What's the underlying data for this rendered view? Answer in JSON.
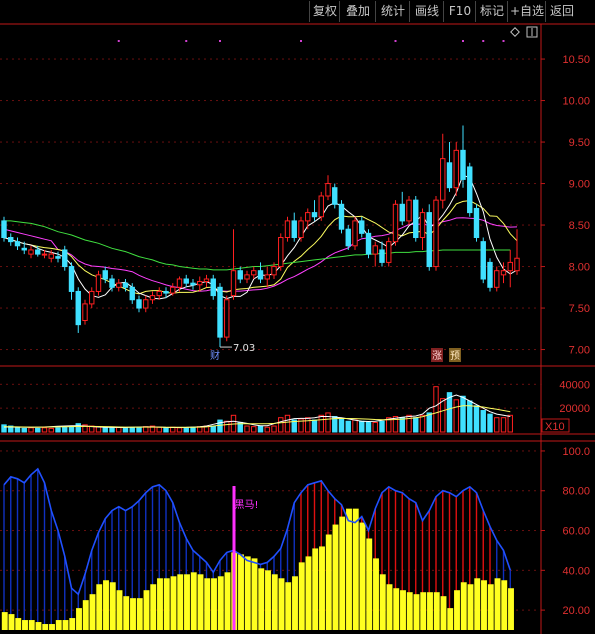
{
  "toolbar": {
    "buttons": [
      "复权",
      "叠加",
      "统计",
      "画线",
      "F10",
      "标记",
      "+自选",
      "返回"
    ]
  },
  "colors": {
    "background": "#000000",
    "up": "#ff2020",
    "down": "#40e0ff",
    "ma5": "#ffffff",
    "ma10": "#ffff60",
    "ma20": "#ff40ff",
    "ma60": "#40e040",
    "axis": "#c01818",
    "indicator_blue": "#1030c0",
    "indicator_red": "#e01010",
    "indicator_yellow": "#ffff20",
    "signal": "#ff30ff"
  },
  "annotations": {
    "low_price": "7.03",
    "finance_tag": "财",
    "rise_tag": "涨",
    "forecast_tag": "预",
    "signal_text": "黑马!",
    "volume_unit": "X10"
  },
  "chart_data": [
    {
      "type": "candlestick",
      "name": "price",
      "y_ticks": [
        "10.50",
        "10.00",
        "9.50",
        "9.00",
        "8.50",
        "8.00",
        "7.50",
        "7.00"
      ],
      "ylim": [
        6.85,
        10.85
      ],
      "candles": [
        {
          "o": 8.55,
          "h": 8.6,
          "l": 8.3,
          "c": 8.35
        },
        {
          "o": 8.35,
          "h": 8.4,
          "l": 8.25,
          "c": 8.3
        },
        {
          "o": 8.3,
          "h": 8.35,
          "l": 8.2,
          "c": 8.25
        },
        {
          "o": 8.22,
          "h": 8.3,
          "l": 8.15,
          "c": 8.2
        },
        {
          "o": 8.15,
          "h": 8.25,
          "l": 8.1,
          "c": 8.2
        },
        {
          "o": 8.2,
          "h": 8.25,
          "l": 8.12,
          "c": 8.15
        },
        {
          "o": 8.15,
          "h": 8.2,
          "l": 8.1,
          "c": 8.15
        },
        {
          "o": 8.1,
          "h": 8.2,
          "l": 8.05,
          "c": 8.15
        },
        {
          "o": 8.12,
          "h": 8.18,
          "l": 8.05,
          "c": 8.1
        },
        {
          "o": 8.2,
          "h": 8.25,
          "l": 7.95,
          "c": 8.0
        },
        {
          "o": 8.0,
          "h": 8.05,
          "l": 7.6,
          "c": 7.7
        },
        {
          "o": 7.7,
          "h": 7.75,
          "l": 7.2,
          "c": 7.3
        },
        {
          "o": 7.35,
          "h": 7.6,
          "l": 7.3,
          "c": 7.55
        },
        {
          "o": 7.55,
          "h": 7.75,
          "l": 7.5,
          "c": 7.7
        },
        {
          "o": 7.7,
          "h": 7.95,
          "l": 7.65,
          "c": 7.9
        },
        {
          "o": 7.95,
          "h": 8.0,
          "l": 7.8,
          "c": 7.85
        },
        {
          "o": 7.85,
          "h": 7.9,
          "l": 7.7,
          "c": 7.75
        },
        {
          "o": 7.75,
          "h": 7.85,
          "l": 7.7,
          "c": 7.8
        },
        {
          "o": 7.8,
          "h": 7.85,
          "l": 7.7,
          "c": 7.75
        },
        {
          "o": 7.75,
          "h": 7.8,
          "l": 7.55,
          "c": 7.6
        },
        {
          "o": 7.6,
          "h": 7.65,
          "l": 7.45,
          "c": 7.5
        },
        {
          "o": 7.5,
          "h": 7.65,
          "l": 7.45,
          "c": 7.6
        },
        {
          "o": 7.6,
          "h": 7.7,
          "l": 7.55,
          "c": 7.65
        },
        {
          "o": 7.65,
          "h": 7.75,
          "l": 7.6,
          "c": 7.7
        },
        {
          "o": 7.7,
          "h": 7.75,
          "l": 7.62,
          "c": 7.68
        },
        {
          "o": 7.68,
          "h": 7.8,
          "l": 7.65,
          "c": 7.75
        },
        {
          "o": 7.75,
          "h": 7.88,
          "l": 7.7,
          "c": 7.85
        },
        {
          "o": 7.85,
          "h": 7.9,
          "l": 7.75,
          "c": 7.8
        },
        {
          "o": 7.8,
          "h": 7.85,
          "l": 7.72,
          "c": 7.78
        },
        {
          "o": 7.78,
          "h": 7.88,
          "l": 7.7,
          "c": 7.82
        },
        {
          "o": 7.82,
          "h": 7.9,
          "l": 7.75,
          "c": 7.85
        },
        {
          "o": 7.85,
          "h": 7.9,
          "l": 7.6,
          "c": 7.65
        },
        {
          "o": 7.75,
          "h": 7.8,
          "l": 7.03,
          "c": 7.15
        },
        {
          "o": 7.15,
          "h": 7.65,
          "l": 7.1,
          "c": 7.6
        },
        {
          "o": 7.65,
          "h": 8.45,
          "l": 7.6,
          "c": 7.95
        },
        {
          "o": 7.95,
          "h": 8.0,
          "l": 7.8,
          "c": 7.85
        },
        {
          "o": 7.85,
          "h": 7.95,
          "l": 7.8,
          "c": 7.9
        },
        {
          "o": 7.9,
          "h": 8.0,
          "l": 7.85,
          "c": 7.95
        },
        {
          "o": 7.95,
          "h": 8.05,
          "l": 7.8,
          "c": 7.85
        },
        {
          "o": 7.85,
          "h": 8.0,
          "l": 7.75,
          "c": 7.9
        },
        {
          "o": 7.9,
          "h": 8.05,
          "l": 7.85,
          "c": 8.0
        },
        {
          "o": 8.0,
          "h": 8.4,
          "l": 7.95,
          "c": 8.35
        },
        {
          "o": 8.35,
          "h": 8.6,
          "l": 8.3,
          "c": 8.55
        },
        {
          "o": 8.55,
          "h": 8.65,
          "l": 8.3,
          "c": 8.35
        },
        {
          "o": 8.35,
          "h": 8.6,
          "l": 8.3,
          "c": 8.55
        },
        {
          "o": 8.55,
          "h": 8.7,
          "l": 8.45,
          "c": 8.65
        },
        {
          "o": 8.65,
          "h": 8.8,
          "l": 8.55,
          "c": 8.6
        },
        {
          "o": 8.6,
          "h": 8.9,
          "l": 8.55,
          "c": 8.85
        },
        {
          "o": 8.85,
          "h": 9.1,
          "l": 8.8,
          "c": 9.0
        },
        {
          "o": 8.95,
          "h": 9.0,
          "l": 8.7,
          "c": 8.75
        },
        {
          "o": 8.75,
          "h": 8.8,
          "l": 8.4,
          "c": 8.45
        },
        {
          "o": 8.45,
          "h": 8.5,
          "l": 8.2,
          "c": 8.25
        },
        {
          "o": 8.25,
          "h": 8.6,
          "l": 8.2,
          "c": 8.55
        },
        {
          "o": 8.55,
          "h": 8.6,
          "l": 8.35,
          "c": 8.4
        },
        {
          "o": 8.4,
          "h": 8.45,
          "l": 8.1,
          "c": 8.15
        },
        {
          "o": 8.15,
          "h": 8.3,
          "l": 8.0,
          "c": 8.25
        },
        {
          "o": 8.2,
          "h": 8.3,
          "l": 8.0,
          "c": 8.05
        },
        {
          "o": 8.05,
          "h": 8.35,
          "l": 8.0,
          "c": 8.3
        },
        {
          "o": 8.3,
          "h": 8.8,
          "l": 8.25,
          "c": 8.75
        },
        {
          "o": 8.75,
          "h": 8.9,
          "l": 8.5,
          "c": 8.55
        },
        {
          "o": 8.55,
          "h": 8.85,
          "l": 8.5,
          "c": 8.8
        },
        {
          "o": 8.8,
          "h": 8.85,
          "l": 8.3,
          "c": 8.35
        },
        {
          "o": 8.35,
          "h": 8.7,
          "l": 8.2,
          "c": 8.65
        },
        {
          "o": 8.65,
          "h": 8.75,
          "l": 7.95,
          "c": 8.0
        },
        {
          "o": 8.0,
          "h": 8.85,
          "l": 7.95,
          "c": 8.8
        },
        {
          "o": 8.8,
          "h": 9.6,
          "l": 8.7,
          "c": 9.3
        },
        {
          "o": 9.25,
          "h": 9.5,
          "l": 8.9,
          "c": 8.95
        },
        {
          "o": 8.95,
          "h": 9.5,
          "l": 8.85,
          "c": 9.4
        },
        {
          "o": 9.4,
          "h": 9.7,
          "l": 8.95,
          "c": 9.05
        },
        {
          "o": 9.2,
          "h": 9.25,
          "l": 8.6,
          "c": 8.65
        },
        {
          "o": 8.7,
          "h": 8.75,
          "l": 8.3,
          "c": 8.35
        },
        {
          "o": 8.3,
          "h": 8.35,
          "l": 7.8,
          "c": 7.85
        },
        {
          "o": 8.05,
          "h": 8.1,
          "l": 7.7,
          "c": 7.75
        },
        {
          "o": 7.75,
          "h": 8.0,
          "l": 7.7,
          "c": 7.95
        },
        {
          "o": 7.9,
          "h": 8.05,
          "l": 7.8,
          "c": 7.95
        },
        {
          "o": 7.95,
          "h": 8.2,
          "l": 7.75,
          "c": 8.05
        },
        {
          "o": 7.95,
          "h": 8.45,
          "l": 7.9,
          "c": 8.1
        }
      ],
      "mark_dots": [
        17,
        27,
        32,
        44,
        58,
        68,
        71,
        74
      ]
    },
    {
      "type": "bar",
      "name": "volume",
      "y_ticks": [
        "40000",
        "20000"
      ],
      "ylim": [
        0,
        52000
      ],
      "values": [
        6000,
        5000,
        4000,
        3000,
        3500,
        3000,
        3500,
        3000,
        3500,
        4000,
        5000,
        7000,
        6000,
        5000,
        4500,
        4000,
        3500,
        4000,
        3500,
        3500,
        4000,
        4500,
        5000,
        4000,
        3500,
        4000,
        3500,
        3500,
        4000,
        4500,
        5000,
        5000,
        10000,
        9000,
        14000,
        8000,
        5000,
        4500,
        5000,
        4000,
        5000,
        12000,
        14000,
        10000,
        11000,
        12000,
        10000,
        14000,
        16000,
        13000,
        11000,
        9000,
        10000,
        9000,
        8000,
        8000,
        9000,
        12000,
        13000,
        12000,
        14000,
        12000,
        14000,
        16000,
        38000,
        28000,
        33000,
        27000,
        30000,
        26000,
        22000,
        18000,
        15000,
        12000,
        12000,
        14000
      ],
      "ma5": [
        4200,
        4200,
        4100,
        4000,
        4000,
        4000,
        4200,
        4500,
        4800,
        5000,
        5200,
        5200,
        5000,
        4500,
        4200,
        4000,
        3900,
        3800,
        3800,
        4000,
        4200,
        4300,
        4300,
        4100,
        3900,
        3800,
        3800,
        3900,
        4100,
        4400,
        5000,
        6500,
        7700,
        8600,
        9000,
        8200,
        7200,
        6000,
        5200,
        5300,
        7000,
        8600,
        10000,
        11200,
        11400,
        11400,
        12000,
        13000,
        13000,
        12500,
        12000,
        11000,
        10000,
        9000,
        8800,
        9000,
        9800,
        10800,
        11600,
        12400,
        13000,
        13400,
        15000,
        20000,
        22000,
        26000,
        29000,
        31000,
        29000,
        26000,
        23000,
        20000,
        17000,
        15000,
        14000,
        13000
      ],
      "ma10": [
        4500,
        4400,
        4300,
        4200,
        4100,
        4100,
        4100,
        4200,
        4300,
        4400,
        4500,
        4600,
        4700,
        4700,
        4600,
        4500,
        4400,
        4200,
        4100,
        4100,
        4100,
        4100,
        4100,
        4100,
        4000,
        4000,
        4000,
        4000,
        4000,
        4100,
        4300,
        5000,
        5600,
        6200,
        6700,
        7000,
        7000,
        7000,
        7000,
        7000,
        7200,
        7700,
        8300,
        8800,
        9100,
        9400,
        9800,
        10300,
        10800,
        11200,
        11300,
        11300,
        11200,
        11000,
        10800,
        10500,
        10300,
        10300,
        10500,
        10800,
        11300,
        12000,
        12800,
        14500,
        16000,
        17800,
        19500,
        21000,
        22000,
        22000,
        21500,
        21000,
        20000,
        19000,
        18000,
        17000
      ]
    },
    {
      "type": "area",
      "name": "indicator",
      "y_ticks": [
        "100.0",
        "80.00",
        "60.00",
        "40.00",
        "20.00"
      ],
      "ylim": [
        10,
        104
      ],
      "line": [
        83,
        87,
        86,
        84,
        88,
        91,
        84,
        70,
        60,
        47,
        31,
        28,
        38,
        50,
        59,
        66,
        70,
        72,
        70,
        72,
        75,
        79,
        82,
        83,
        80,
        74,
        64,
        56,
        50,
        47,
        44,
        39,
        45,
        49,
        50,
        48,
        45,
        44,
        43,
        44,
        47,
        51,
        61,
        74,
        79,
        83,
        84,
        85,
        80,
        76,
        73,
        65,
        64,
        67,
        60,
        71,
        79,
        82,
        80,
        79,
        76,
        74,
        65,
        70,
        77,
        80,
        79,
        77,
        80,
        82,
        79,
        70,
        62,
        55,
        50,
        40
      ],
      "yellow": [
        19,
        18,
        16,
        15,
        15,
        14,
        13,
        13,
        15,
        15,
        16,
        21,
        25,
        28,
        33,
        35,
        34,
        30,
        27,
        26,
        26,
        30,
        33,
        36,
        36,
        37,
        38,
        38,
        39,
        38,
        36,
        36,
        37,
        39,
        49,
        48,
        47,
        46,
        41,
        40,
        38,
        36,
        34,
        37,
        44,
        47,
        51,
        52,
        58,
        63,
        67,
        71,
        71,
        64,
        56,
        46,
        38,
        33,
        31,
        30,
        29,
        28,
        29,
        29,
        29,
        27,
        21,
        30,
        34,
        33,
        36,
        35,
        33,
        36,
        35,
        31
      ]
    }
  ]
}
